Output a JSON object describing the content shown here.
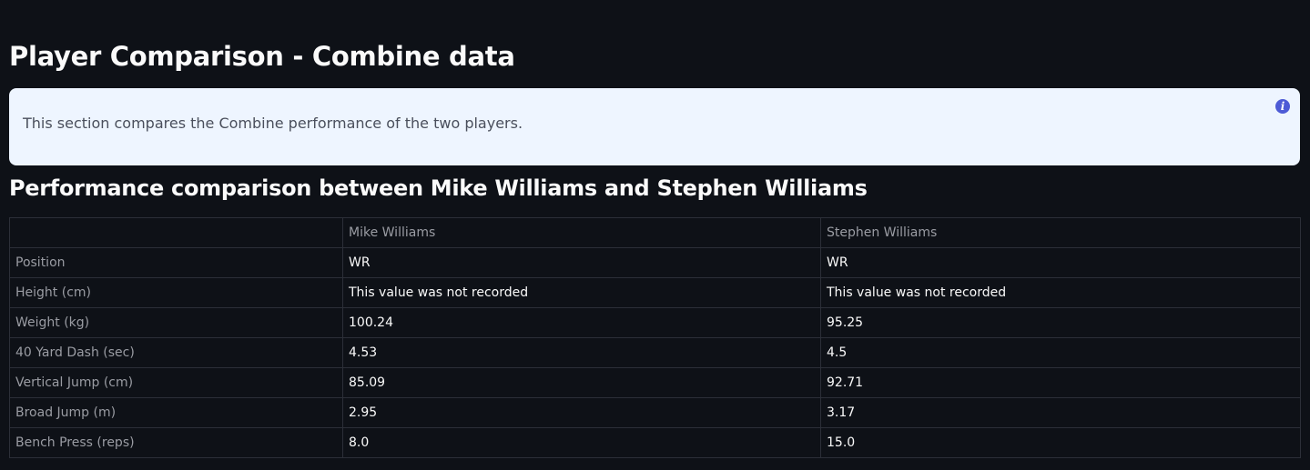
{
  "page": {
    "title": "Player Comparison - Combine data"
  },
  "info": {
    "text": "This section compares the Combine performance of the two players.",
    "icon": "info-icon"
  },
  "comparison": {
    "heading": "Performance comparison between Mike Williams and Stephen Williams",
    "columns": [
      "",
      "Mike Williams",
      "Stephen Williams"
    ],
    "rows": [
      {
        "label": "Position",
        "values": [
          "WR",
          "WR"
        ]
      },
      {
        "label": "Height (cm)",
        "values": [
          "This value was not recorded",
          "This value was not recorded"
        ]
      },
      {
        "label": "Weight (kg)",
        "values": [
          "100.24",
          "95.25"
        ]
      },
      {
        "label": "40 Yard Dash (sec)",
        "values": [
          "4.53",
          "4.5"
        ]
      },
      {
        "label": "Vertical Jump (cm)",
        "values": [
          "85.09",
          "92.71"
        ]
      },
      {
        "label": "Broad Jump (m)",
        "values": [
          "2.95",
          "3.17"
        ]
      },
      {
        "label": "Bench Press (reps)",
        "values": [
          "8.0",
          "15.0"
        ]
      }
    ]
  },
  "colors": {
    "background": "#0e1117",
    "info_background": "#eef5ff",
    "info_icon": "#4d5bd6"
  }
}
